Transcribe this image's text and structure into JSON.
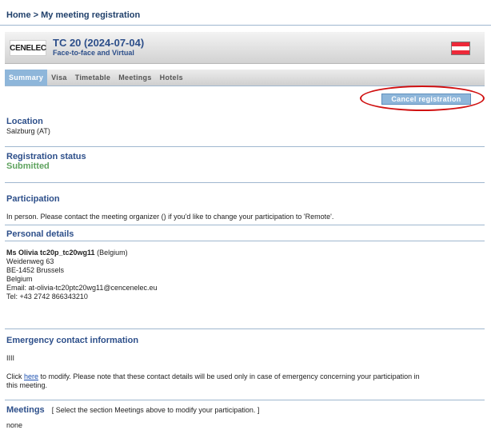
{
  "breadcrumb": {
    "home": "Home",
    "separator": ">",
    "current": "My meeting registration"
  },
  "meeting": {
    "logo_text": "CENELEC",
    "title": "TC 20 (2024-07-04)",
    "subtitle": "Face-to-face and Virtual",
    "flag_colors": [
      "#ed2939",
      "#ffffff",
      "#ed2939"
    ]
  },
  "tabs": [
    {
      "label": "Summary",
      "active": true
    },
    {
      "label": "Visa",
      "active": false
    },
    {
      "label": "Timetable",
      "active": false
    },
    {
      "label": "Meetings",
      "active": false
    },
    {
      "label": "Hotels",
      "active": false
    }
  ],
  "actions": {
    "cancel_label": "Cancel registration"
  },
  "location": {
    "title": "Location",
    "value": "Salzburg (AT)"
  },
  "registration_status": {
    "title": "Registration status",
    "value": "Submitted",
    "color": "#5fa35f"
  },
  "participation": {
    "title": "Participation",
    "text": "In person. Please contact the meeting organizer () if you'd like to change your participation to 'Remote'."
  },
  "personal_details": {
    "title": "Personal details",
    "name": "Ms Olivia tc20p_tc20wg11",
    "country_suffix": "(Belgium)",
    "address_line1": "Weidenweg 63",
    "address_line2": "BE-1452 Brussels",
    "country": "Belgium",
    "email": "Email: at-olivia-tc20ptc20wg11@cencenelec.eu",
    "tel": "Tel: +43 2742 866343210"
  },
  "emergency": {
    "title": "Emergency contact information",
    "value": "IIII",
    "click_prefix": "Click",
    "link_label": "here",
    "text_line1": "to modify. Please note that these contact details will be used only in case of emergency concerning your participation in",
    "text_line2": "this meeting."
  },
  "meetings": {
    "title": "Meetings",
    "note": "[ Select the section Meetings above to modify your participation. ]",
    "value": "none"
  }
}
